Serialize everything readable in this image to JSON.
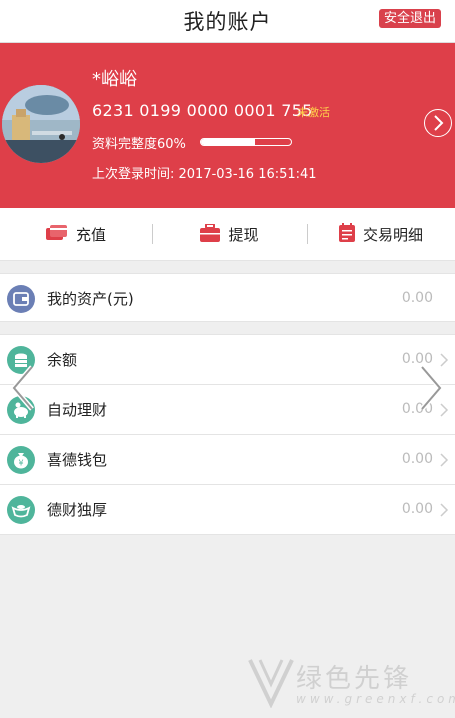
{
  "header": {
    "title": "我的账户",
    "logout_label": "安全退出"
  },
  "profile": {
    "name": "*峪峪",
    "card_number": "6231 0199 0000 0001 755",
    "card_status": "未激活",
    "completeness_label": "资料完整度60%",
    "completeness_value": 0.6,
    "last_login": "上次登录时间: 2017-03-16 16:51:41"
  },
  "actions": [
    {
      "label": "充值",
      "icon": "wallet-cards-icon"
    },
    {
      "label": "提现",
      "icon": "briefcase-icon"
    },
    {
      "label": "交易明细",
      "icon": "receipt-icon"
    }
  ],
  "assets": {
    "label": "我的资产(元)",
    "value": "0.00",
    "icon": "wallet-icon"
  },
  "items": [
    {
      "label": "余额",
      "value": "0.00",
      "icon": "coins-icon"
    },
    {
      "label": "自动理财",
      "value": "0.00",
      "icon": "piggy-bank-icon"
    },
    {
      "label": "喜德钱包",
      "value": "0.00",
      "icon": "money-bag-icon"
    },
    {
      "label": "德财独厚",
      "value": "0.00",
      "icon": "gold-ingot-icon"
    }
  ],
  "watermark": {
    "text": "绿色先锋",
    "sub": "www.greenxf.com"
  },
  "colors": {
    "brand_red": "#de3f49",
    "status_yellow": "#ffd34a",
    "icon_green": "#4fb59b",
    "icon_blue": "#6b7fb5"
  }
}
